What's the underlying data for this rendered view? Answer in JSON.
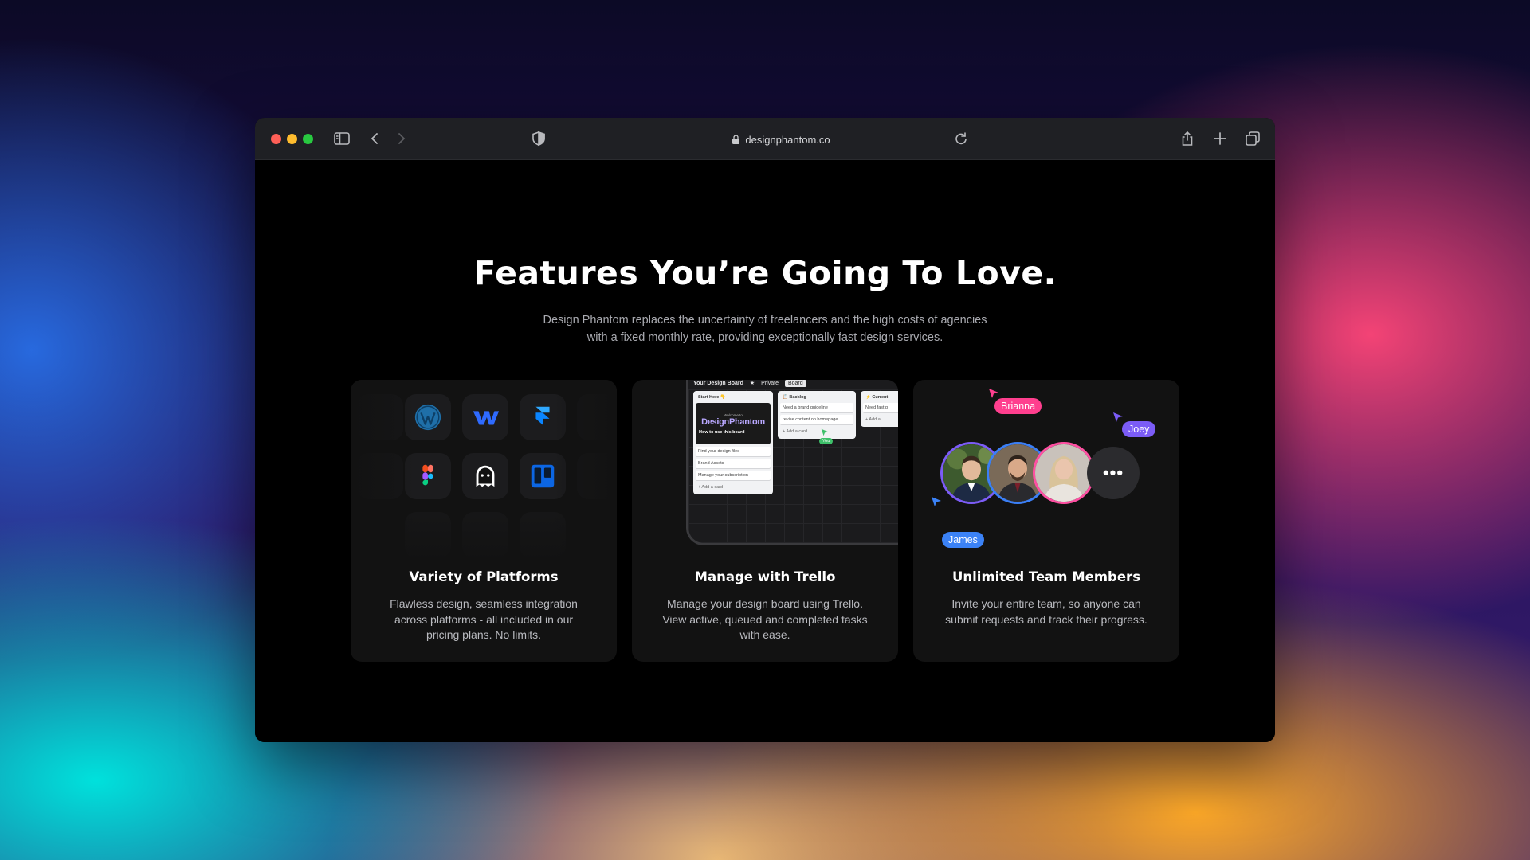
{
  "browser": {
    "url": "designphantom.co",
    "icons": [
      "sidebar-icon",
      "back-icon",
      "forward-icon",
      "shield-icon",
      "lock-icon",
      "reload-icon",
      "share-icon",
      "new-tab-icon",
      "tabs-overview-icon"
    ]
  },
  "section": {
    "heading": "Features You’re Going To Love.",
    "subtitle": "Design Phantom replaces the uncertainty of freelancers and the high costs of agencies with a fixed monthly rate, providing exceptionally fast design services."
  },
  "cards": [
    {
      "title": "Variety of Platforms",
      "description": "Flawless design, seamless integration across platforms - all included in our pricing plans. No limits.",
      "icons": [
        "wordpress-icon",
        "webflow-icon",
        "framer-icon",
        "figma-icon",
        "ghost-icon",
        "trello-icon"
      ]
    },
    {
      "title": "Manage with Trello",
      "description": "Manage your design board using Trello. View active, queued and completed tasks with ease.",
      "board": {
        "title": "Your Design Board",
        "visibility": "Private",
        "view": "Board",
        "lists": [
          {
            "name": "Start Here 👇",
            "welcome_small": "Welcome to",
            "welcome_brand": "DesignPhantom",
            "welcome_caption": "How to use this board",
            "items": [
              "Find your design files",
              "Brand Assets",
              "Manage your subscription"
            ],
            "add": "+ Add a card"
          },
          {
            "name": "📋 Backlog",
            "items": [
              "Need a brand guideline",
              "revise content on homepage"
            ],
            "add": "+ Add a card"
          },
          {
            "name": "⚡ Current",
            "items": [
              "Need fast p"
            ],
            "add": "+ Add a"
          }
        ],
        "cursor_tag": "You"
      }
    },
    {
      "title": "Unlimited Team Members",
      "description": "Invite your entire team, so anyone can submit requests and track their progress.",
      "team": {
        "cursors": [
          {
            "name": "Brianna",
            "color": "#ff3f8e"
          },
          {
            "name": "Joey",
            "color": "#7b5cf6"
          },
          {
            "name": "James",
            "color": "#3b82f6"
          }
        ],
        "avatar_rings": [
          "#7c5cf6",
          "#3b7ff6",
          "#ff4fa2"
        ],
        "more": "•••"
      }
    }
  ]
}
